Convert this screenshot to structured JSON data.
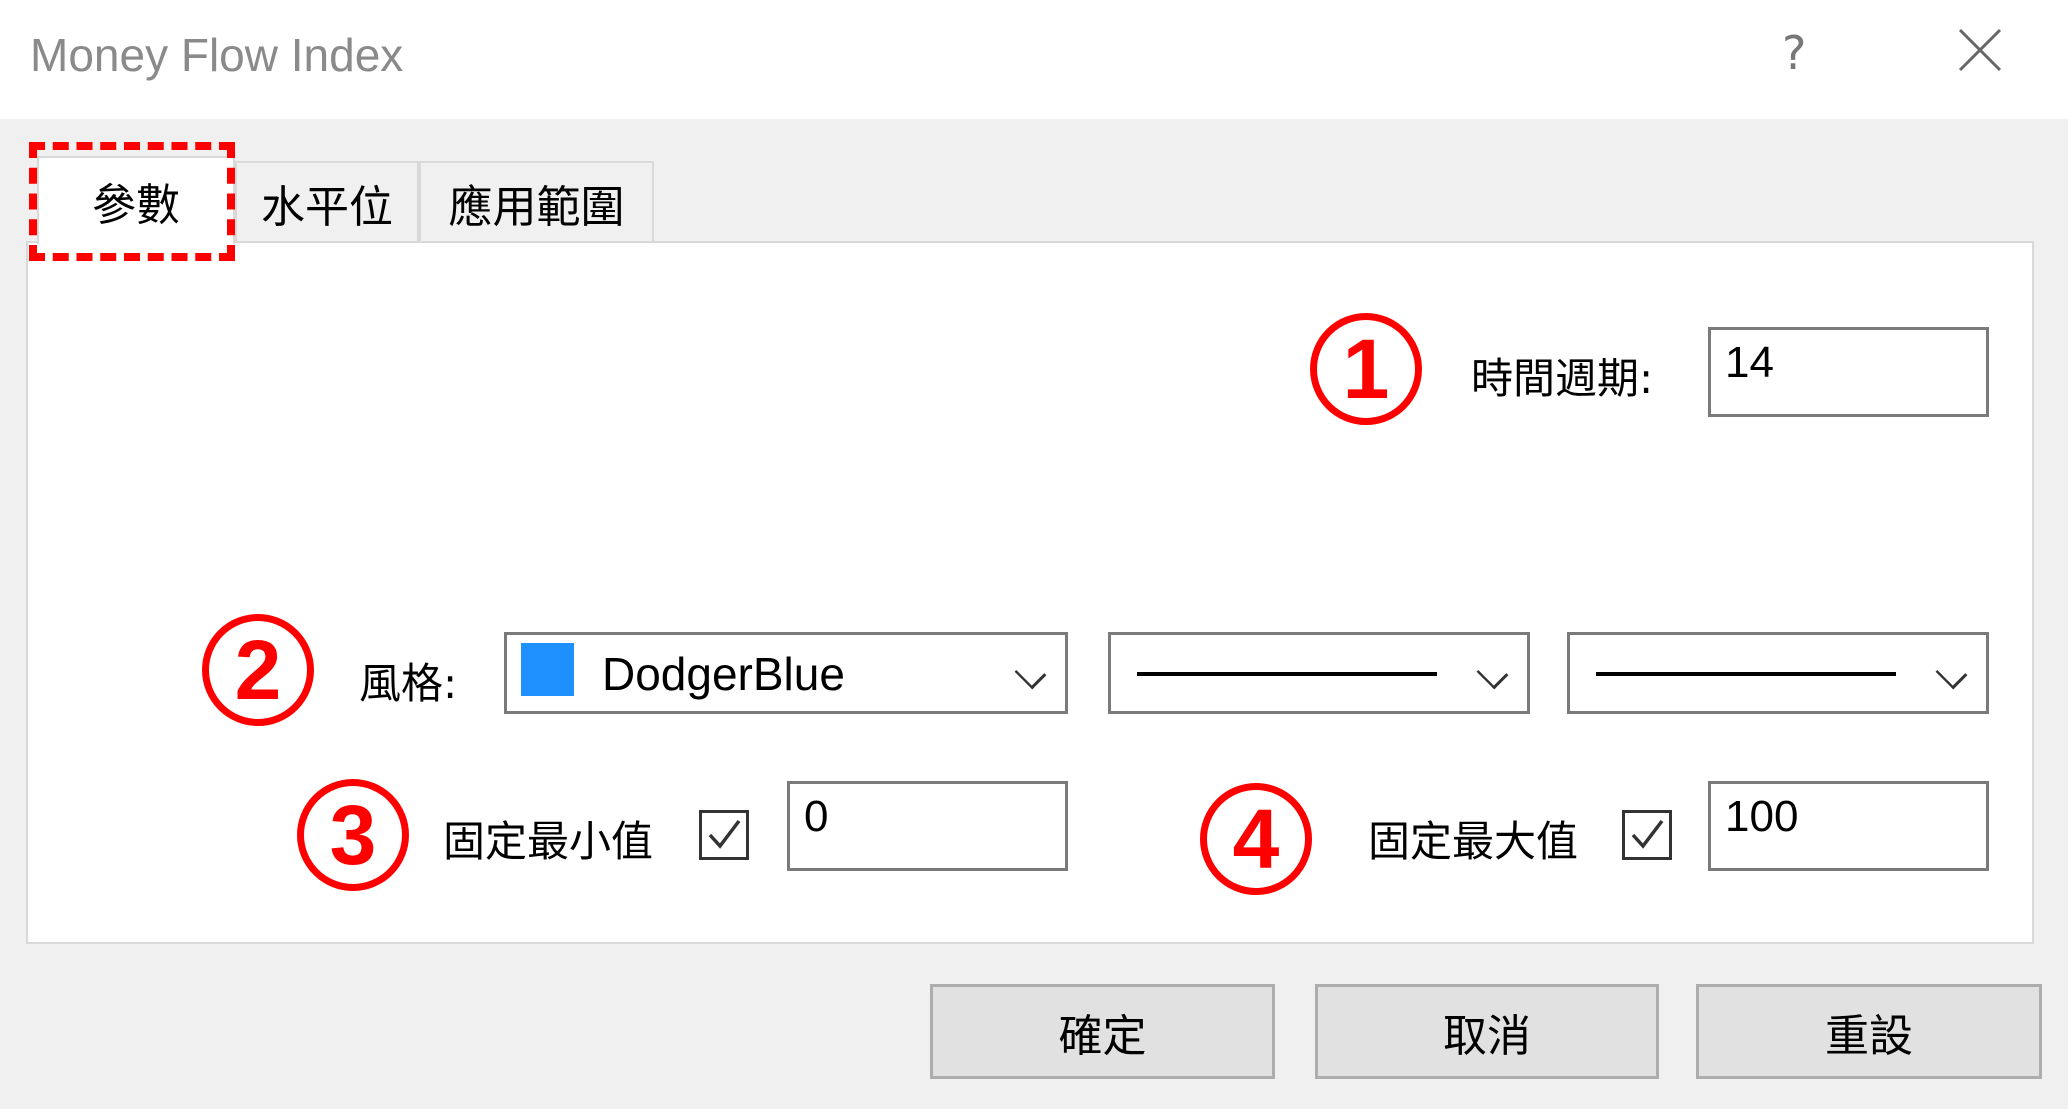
{
  "window": {
    "title": "Money Flow Index",
    "help_label": "?",
    "close_icon": "close-icon"
  },
  "tabs": [
    {
      "label": "參數",
      "active": true
    },
    {
      "label": "水平位",
      "active": false
    },
    {
      "label": "應用範圍",
      "active": false
    }
  ],
  "annotations": {
    "marker1": "1",
    "marker2": "2",
    "marker3": "3",
    "marker4": "4",
    "color": "#ff0000"
  },
  "params": {
    "period_label": "時間週期:",
    "period_value": "14",
    "style_label": "風格:",
    "color_name": "DodgerBlue",
    "color_hex": "#1e90ff",
    "line_style": "solid",
    "line_width": "solid-thin",
    "fixed_min_label": "固定最小值",
    "fixed_min_checked": true,
    "fixed_min_value": "0",
    "fixed_max_label": "固定最大值",
    "fixed_max_checked": true,
    "fixed_max_value": "100"
  },
  "buttons": {
    "ok": "確定",
    "cancel": "取消",
    "reset": "重設"
  }
}
